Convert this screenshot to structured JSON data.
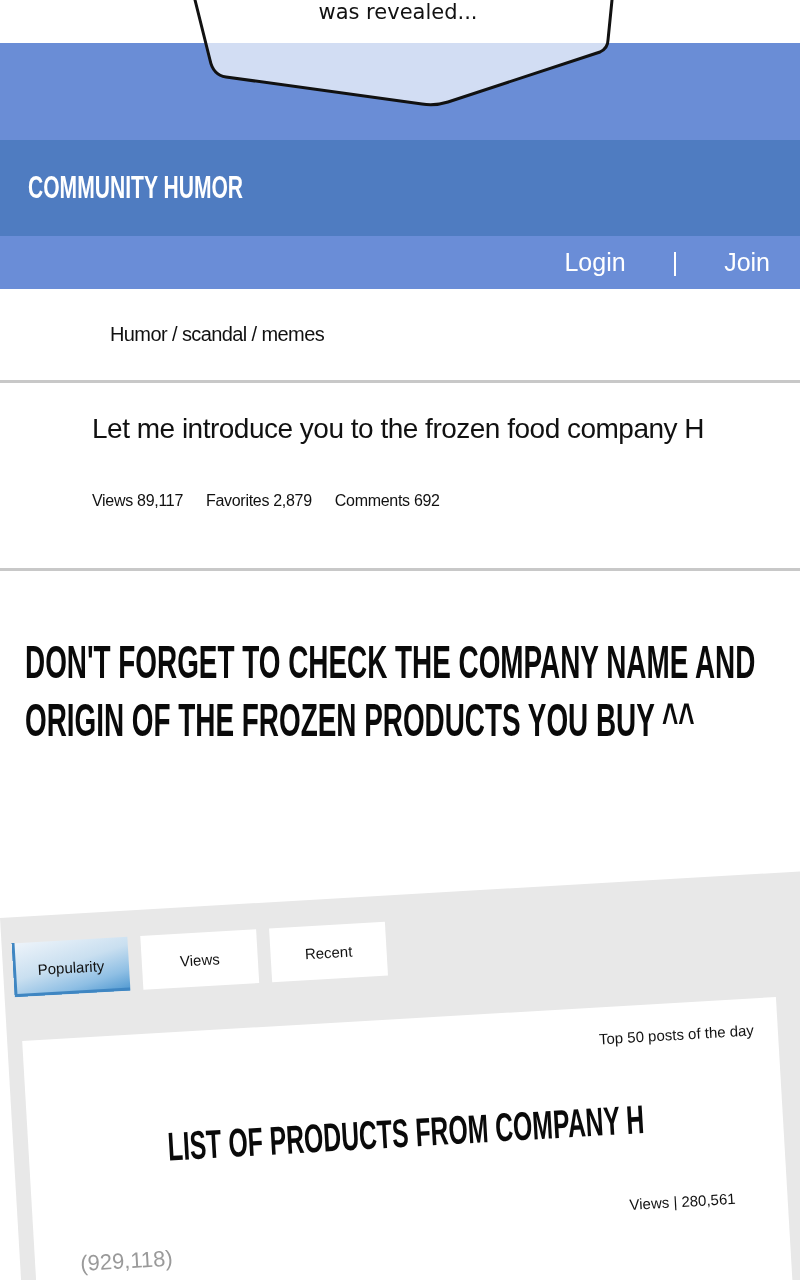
{
  "bubble": {
    "text": "was revealed..."
  },
  "site_header": {
    "title": "COMMUNITY HUMOR"
  },
  "nav": {
    "links": [
      {
        "label": "Login"
      },
      {
        "label": "Join"
      }
    ],
    "separator": "|"
  },
  "breadcrumb": "Humor / scandal / memes",
  "post": {
    "title": "Let me introduce you to the frozen food company H",
    "stats": [
      "Views 89,117",
      "Favorites 2,879",
      "Comments 692"
    ]
  },
  "caption": "DON'T FORGET TO CHECK THE COMPANY NAME AND ORIGIN OF THE FROZEN PRODUCTS YOU BUY ^^",
  "ranking_panel": {
    "tabs": [
      {
        "label": "Popularity",
        "selected": true
      },
      {
        "label": "Views",
        "selected": false
      },
      {
        "label": "Recent",
        "selected": false
      }
    ],
    "subtitle": "Top 50 posts of the day",
    "heading": "LIST OF PRODUCTS FROM COMPANY H",
    "views": "Views | 280,561",
    "entry": "(929,118)"
  }
}
